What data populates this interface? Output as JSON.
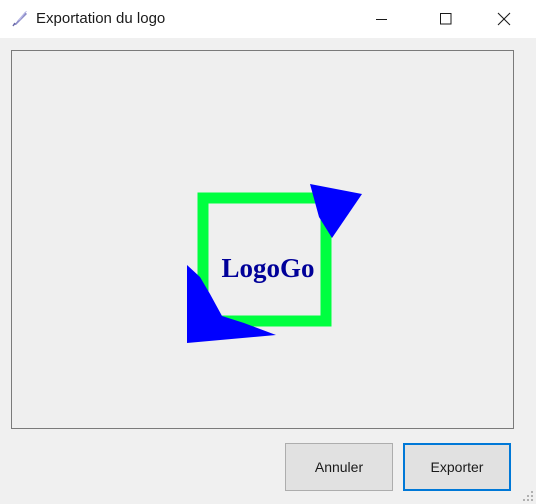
{
  "window": {
    "title": "Exportation du logo"
  },
  "preview": {
    "logo_text": "LogoGo",
    "colors": {
      "frame": "#00ff40",
      "shapes": "#0000ff",
      "text": "#000099",
      "panel_bg": "#efefef"
    }
  },
  "buttons": {
    "cancel_label": "Annuler",
    "export_label": "Exporter"
  },
  "icons": {
    "app": "feather-icon",
    "minimize": "minimize-icon",
    "maximize": "maximize-icon",
    "close": "close-icon",
    "resize": "resize-grip-icon"
  }
}
